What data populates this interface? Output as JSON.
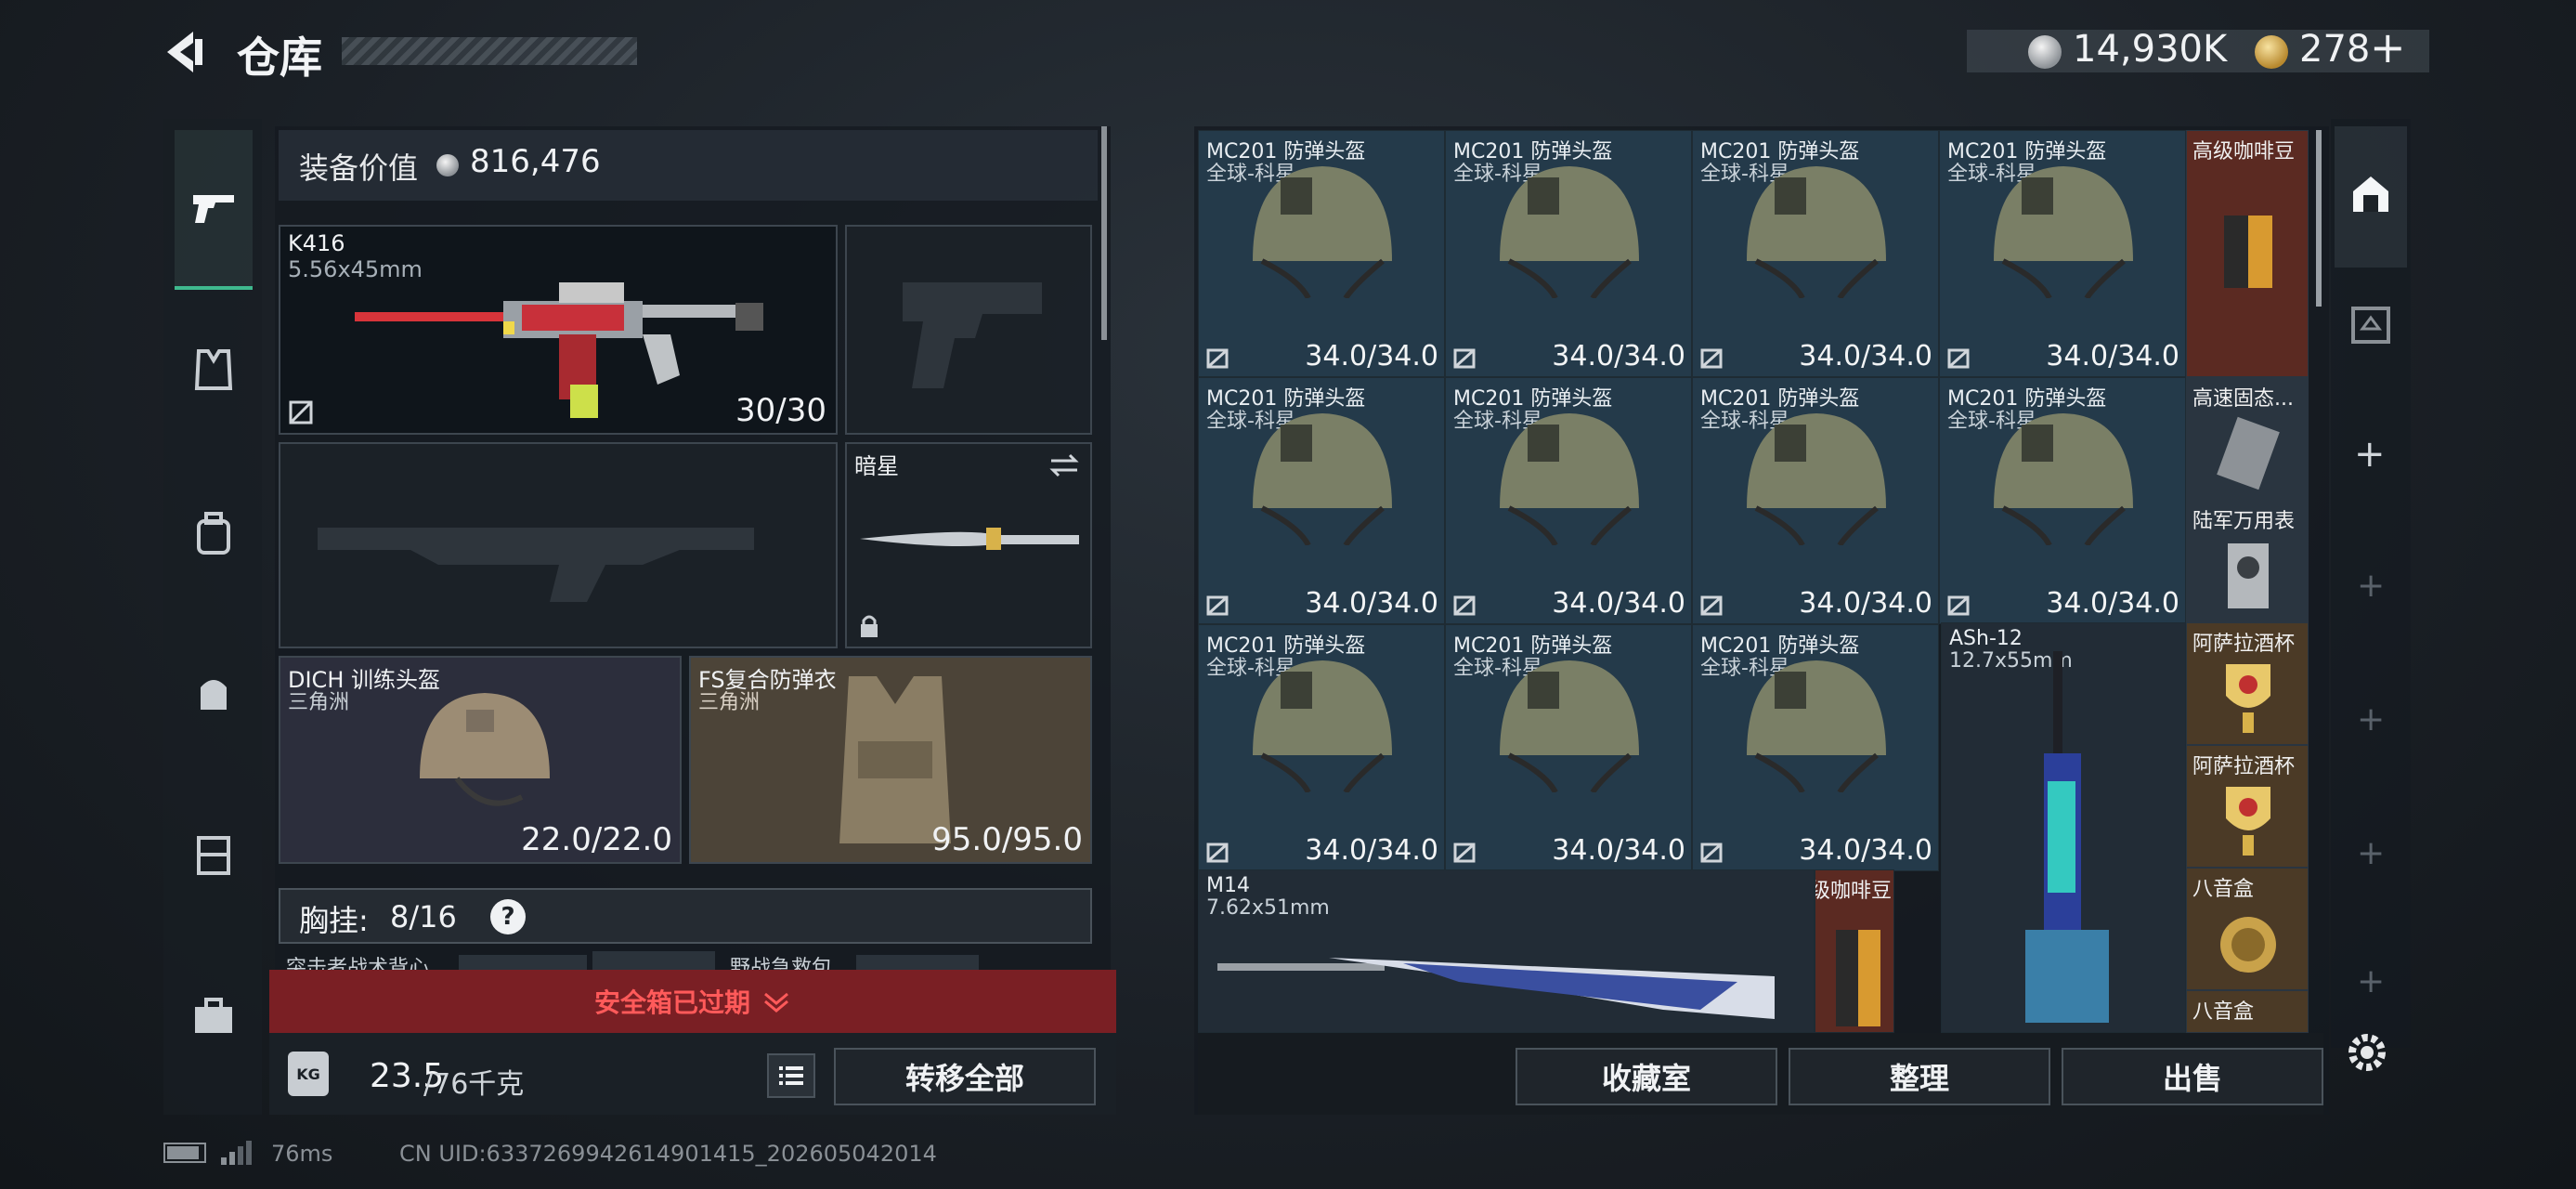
{
  "header": {
    "title": "仓库",
    "silver_amount": "14,930K",
    "gold_amount": "278"
  },
  "loadout": {
    "equip_value_label": "装备价值",
    "equip_value": "816,476",
    "primary": {
      "name": "K416",
      "caliber": "5.56x45mm",
      "ammo": "30/30"
    },
    "melee": {
      "name": "暗星"
    },
    "helmet": {
      "name": "DICH 训练头盔",
      "map": "三角洲",
      "durability": "22.0/22.0"
    },
    "armor": {
      "name": "FS复合防弹衣",
      "map": "三角洲",
      "durability": "95.0/95.0"
    },
    "chest_rig": {
      "label": "胸挂:",
      "count": "8/16",
      "help": "?"
    },
    "peek_items": [
      "突击者战术背心",
      "野战急救包"
    ],
    "safe_box_expired": "安全箱已过期",
    "weight_label": "KG",
    "weight_current": "23.5",
    "weight_max": "/76千克",
    "transfer_all": "转移全部"
  },
  "stash": {
    "helmet_name": "MC201 防弹头盔",
    "helmet_sub": "全球-科星",
    "helmet_durability": "34.0/34.0",
    "m14": {
      "name": "M14",
      "caliber": "7.62x51mm"
    },
    "ash12": {
      "name": "ASh-12",
      "caliber": "12.7x55mm"
    },
    "coffee_label": "高级咖啡豆",
    "side_items": [
      "高级咖啡豆",
      "高速固态...",
      "陆军万用表",
      "阿萨拉酒杯",
      "阿萨拉酒杯",
      "八音盒",
      "八音盒"
    ],
    "buttons": {
      "collection": "收藏室",
      "sort": "整理",
      "sell": "出售"
    }
  },
  "status_bar": {
    "ping": "76ms",
    "uid": "CN UID:6337269942614901415_202605042014"
  },
  "colors": {
    "accent_green": "#3fb98e",
    "warning_red": "#e23a3a",
    "safe_bar": "#7a1f24",
    "orange_cell": "#5b2a22",
    "stash_cell": "#243a4a"
  }
}
